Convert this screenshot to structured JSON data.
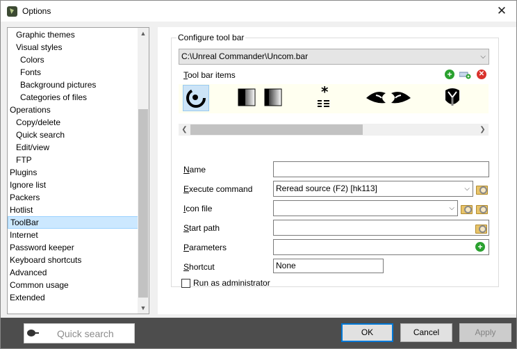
{
  "window": {
    "title": "Options",
    "close_glyph": "✕"
  },
  "tree": {
    "items": [
      {
        "label": "Graphic themes",
        "indent": 1
      },
      {
        "label": "Visual styles",
        "indent": 1
      },
      {
        "label": "Colors",
        "indent": 2
      },
      {
        "label": "Fonts",
        "indent": 2
      },
      {
        "label": "Background pictures",
        "indent": 2
      },
      {
        "label": "Categories of files",
        "indent": 2
      },
      {
        "label": "Operations",
        "indent": 0
      },
      {
        "label": "Copy/delete",
        "indent": 1
      },
      {
        "label": "Quick search",
        "indent": 1
      },
      {
        "label": "Edit/view",
        "indent": 1
      },
      {
        "label": "FTP",
        "indent": 1
      },
      {
        "label": "Plugins",
        "indent": 0
      },
      {
        "label": "Ignore list",
        "indent": 0
      },
      {
        "label": "Packers",
        "indent": 0
      },
      {
        "label": "Hotlist",
        "indent": 0
      },
      {
        "label": "ToolBar",
        "indent": 0,
        "selected": true
      },
      {
        "label": "Internet",
        "indent": 0
      },
      {
        "label": "Password keeper",
        "indent": 0
      },
      {
        "label": "Keyboard shortcuts",
        "indent": 0
      },
      {
        "label": "Advanced",
        "indent": 0
      },
      {
        "label": "Common usage",
        "indent": 0
      },
      {
        "label": "Extended",
        "indent": 0
      }
    ]
  },
  "toolbar_config": {
    "group_title": "Configure tool bar",
    "bar_file": "C:\\Unreal Commander\\Uncom.bar",
    "items_label_u": "T",
    "items_label_rest": "ool bar items",
    "add_icon": "add-icon",
    "separator_icon": "add-separator-icon",
    "delete_icon": "delete-icon"
  },
  "fields": {
    "name_u": "N",
    "name_rest": "ame",
    "name_value": "",
    "execute_u": "E",
    "execute_rest": "xecute command",
    "execute_value": "Reread source (F2) [hk113]",
    "icon_u": "I",
    "icon_rest": "con file",
    "icon_value": "",
    "start_u": "S",
    "start_rest": "tart path",
    "start_value": "",
    "params_u": "P",
    "params_rest": "arameters",
    "params_value": "",
    "shortcut_u": "S",
    "shortcut_rest": "hortcut",
    "shortcut_value": "None",
    "run_admin_label": "Run as administrator",
    "run_admin_checked": false
  },
  "footer": {
    "quick_search_placeholder": "Quick search",
    "ok": "OK",
    "cancel": "Cancel",
    "apply": "Apply"
  },
  "colors": {
    "accent": "#0078d7",
    "selection": "#cce8ff",
    "footer_bg": "#4d4d4d",
    "add_green": "#2aa12f",
    "delete_red": "#d9322c"
  }
}
